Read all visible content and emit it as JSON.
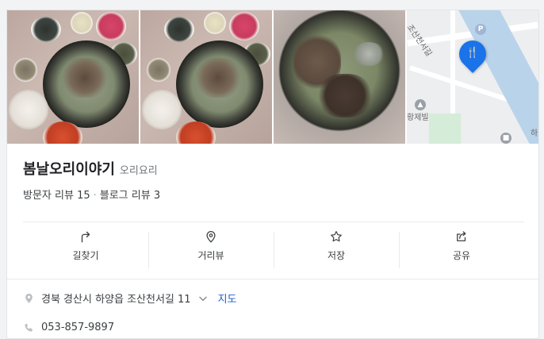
{
  "place": {
    "name": "봄날오리이야기",
    "category": "오리요리",
    "visitor_reviews": "방문자 리뷰 15",
    "separator": "·",
    "blog_reviews": "블로그 리뷰 3"
  },
  "photos": [
    {
      "icon": "food-photo-1"
    },
    {
      "icon": "food-photo-2"
    },
    {
      "icon": "food-photo-3"
    },
    {
      "icon": "map-thumbnail"
    }
  ],
  "map": {
    "road_label": "조산천서길",
    "building_label": "황제빌",
    "edge_label": "하",
    "parking_badge": "P",
    "accent": "#1a73e8"
  },
  "actions": [
    {
      "label": "길찾기",
      "icon": "directions-icon"
    },
    {
      "label": "거리뷰",
      "icon": "location-pin-icon"
    },
    {
      "label": "저장",
      "icon": "star-icon"
    },
    {
      "label": "공유",
      "icon": "share-icon"
    }
  ],
  "address": {
    "text": "경북 경산시 하양읍 조산천서길 11",
    "map_link": "지도"
  },
  "phone": "053-857-9897"
}
